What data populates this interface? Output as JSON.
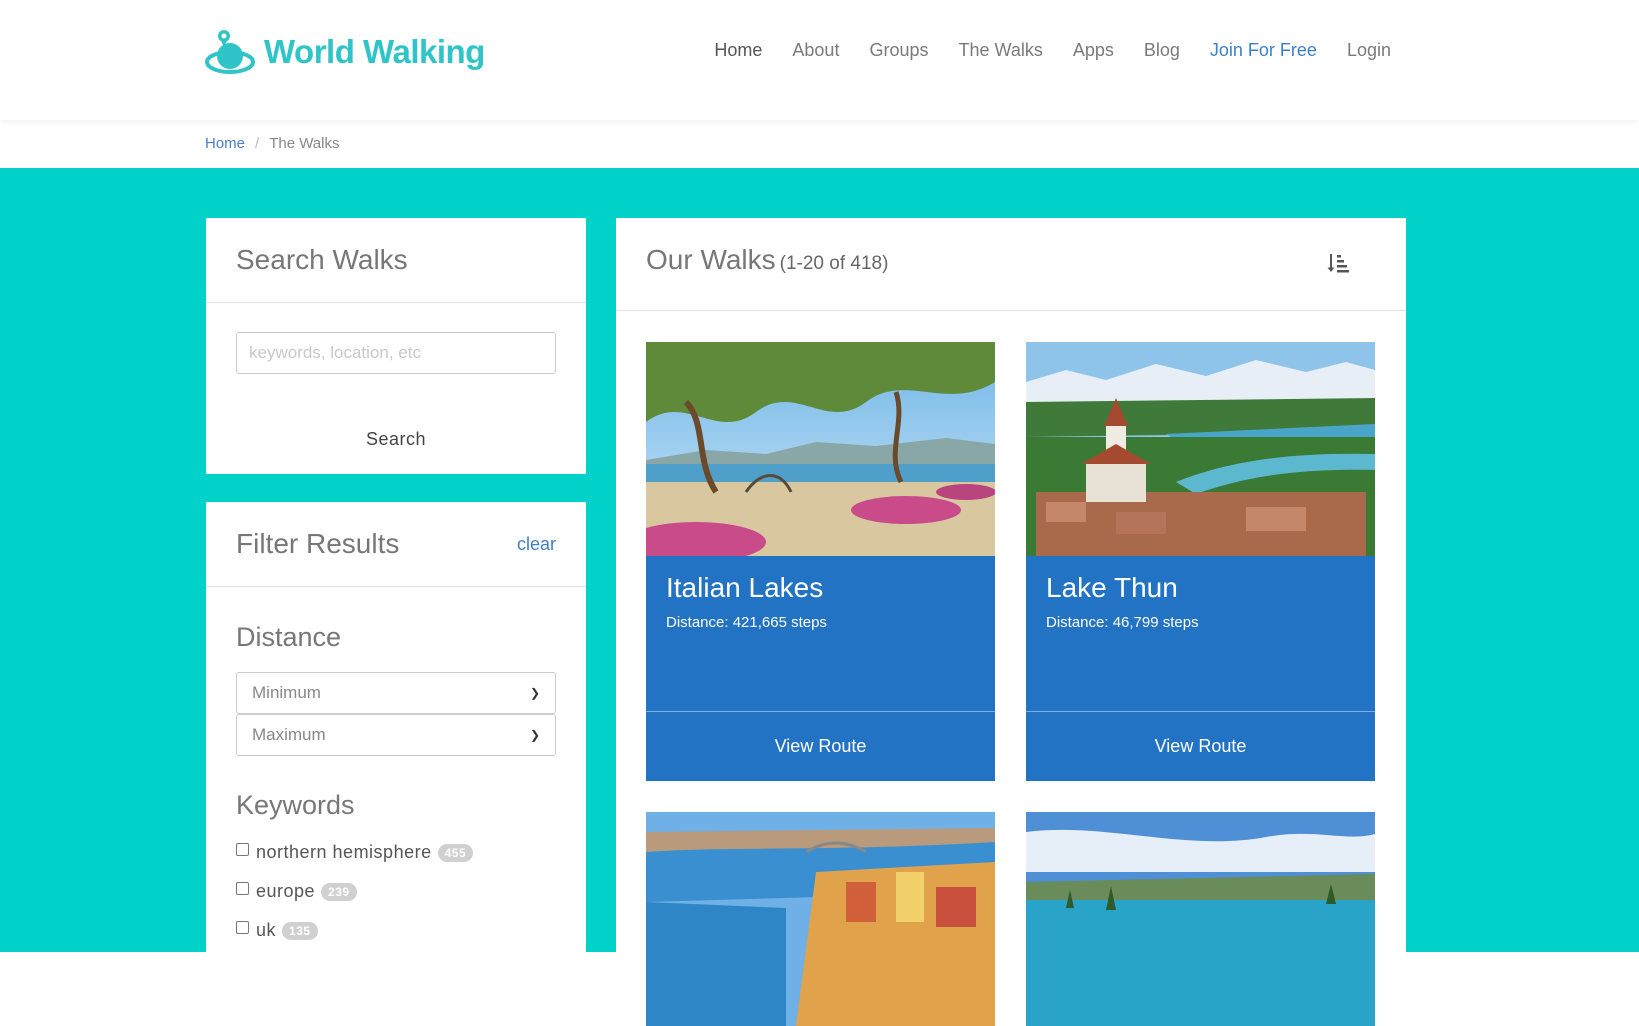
{
  "brand": {
    "name": "World Walking",
    "accent": "#2fc4c7",
    "teal_bg": "#00d1c9",
    "card_blue": "#2373c5"
  },
  "nav": [
    {
      "label": "Home"
    },
    {
      "label": "About"
    },
    {
      "label": "Groups"
    },
    {
      "label": "The Walks"
    },
    {
      "label": "Apps"
    },
    {
      "label": "Blog"
    },
    {
      "label": "Join For Free"
    },
    {
      "label": "Login"
    }
  ],
  "breadcrumb": {
    "home": "Home",
    "separator": "/",
    "current": "The Walks"
  },
  "search": {
    "title": "Search Walks",
    "placeholder": "keywords, location, etc",
    "button": "Search"
  },
  "filter": {
    "title": "Filter Results",
    "clear": "clear",
    "distance": {
      "title": "Distance",
      "min_label": "Minimum",
      "max_label": "Maximum"
    },
    "keywords": {
      "title": "Keywords",
      "items": [
        {
          "label": "northern hemisphere",
          "count": "455"
        },
        {
          "label": "europe",
          "count": "239"
        },
        {
          "label": "uk",
          "count": "135"
        }
      ]
    }
  },
  "walks": {
    "title": "Our Walks",
    "count": "(1-20 of 418)",
    "items": [
      {
        "name": "Italian Lakes",
        "distance": "Distance: 421,665 steps",
        "button": "View Route"
      },
      {
        "name": "Lake Thun",
        "distance": "Distance: 46,799 steps",
        "button": "View Route"
      }
    ]
  },
  "icons": [
    "walking-globe-logo-icon",
    "sort-icon",
    "chevron-down-icon"
  ]
}
